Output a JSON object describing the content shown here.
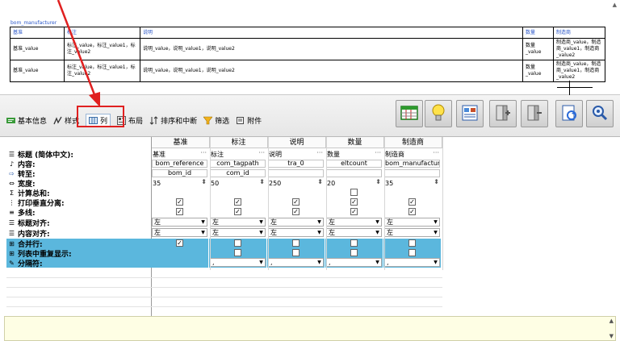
{
  "preview": {
    "title": "bom_manufacturer",
    "headers": [
      "基准",
      "标注",
      "说明",
      "数量",
      "制造商"
    ],
    "rows": [
      [
        "基准_value",
        "标注_value，标注_value1，标注_value2",
        "说明_value，说明_value1，说明_value2",
        "数量_value",
        "制造商_value，制造商_value1，制造商_value2"
      ],
      [
        "基准_value",
        "标注_value，标注_value1，标注_value2",
        "说明_value，说明_value1，说明_value2",
        "数量_value",
        "制造商_value，制造商_value1，制造商_value2"
      ]
    ]
  },
  "tabs": [
    {
      "label": "基本信息",
      "icon": "basic-info-icon"
    },
    {
      "label": "样式",
      "icon": "style-icon"
    },
    {
      "label": "列",
      "icon": "column-icon"
    },
    {
      "label": "布局",
      "icon": "layout-icon"
    },
    {
      "label": "排序和中断",
      "icon": "sort-break-icon"
    },
    {
      "label": "筛选",
      "icon": "filter-icon"
    },
    {
      "label": "附件",
      "icon": "attachment-icon"
    }
  ],
  "toolbar_buttons": [
    "table-grid-icon",
    "lightbulb-icon",
    "report-view-icon",
    "add-column-icon",
    "remove-column-icon",
    "refresh-icon",
    "zoom-icon"
  ],
  "grid": {
    "columns": [
      "基准",
      "标注",
      "说明",
      "数量",
      "制造商"
    ],
    "labels": {
      "title": "标题 (简体中文):",
      "content": "内容:",
      "link": "转至:",
      "width": "宽度:",
      "total": "计算总和:",
      "vsplit": "打印垂直分离:",
      "multiline": "多线:",
      "title_align": "标题对齐:",
      "content_align": "内容对齐:",
      "merge": "合并行:",
      "repeat": "列表中重复显示:",
      "separator": "分隔符:"
    },
    "title_values": [
      "基准",
      "标注",
      "说明",
      "数量",
      "制造商"
    ],
    "content_values": [
      "bom_reference",
      "com_tagpath",
      "tra_0",
      "eltcount",
      "bom_manufacturer"
    ],
    "link_values": [
      "bom_id",
      "com_id",
      "",
      "",
      ""
    ],
    "width_values": [
      "35",
      "50",
      "250",
      "20",
      "35"
    ],
    "align_value": "左",
    "separator_value": ","
  }
}
